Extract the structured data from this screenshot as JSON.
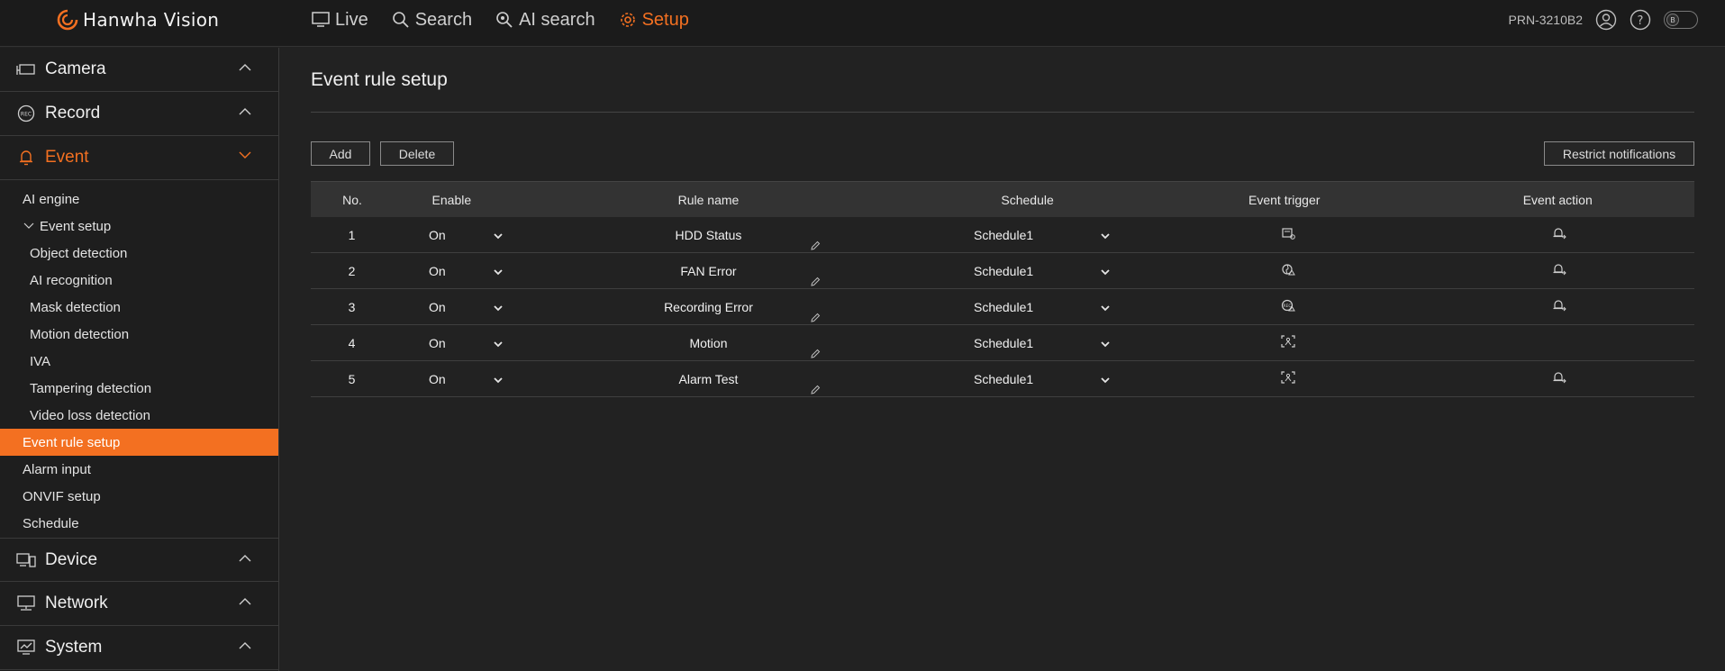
{
  "app": {
    "logo_text": "Hanwha Vision",
    "model": "PRN-3210B2",
    "toggle_label": "B"
  },
  "colors": {
    "accent": "#f37021",
    "bg": "#222222",
    "header_row": "#333333"
  },
  "nav": [
    {
      "label": "Live",
      "icon": "monitor-icon"
    },
    {
      "label": "Search",
      "icon": "search-icon"
    },
    {
      "label": "AI search",
      "icon": "ai-search-icon"
    },
    {
      "label": "Setup",
      "icon": "gear-icon",
      "active": true
    }
  ],
  "sidebar": {
    "camera": "Camera",
    "record": "Record",
    "event": "Event",
    "event_items": {
      "ai_engine": "AI engine",
      "event_setup": "Event setup",
      "object_detection": "Object detection",
      "ai_recognition": "AI recognition",
      "mask_detection": "Mask detection",
      "motion_detection": "Motion detection",
      "iva": "IVA",
      "tampering_detection": "Tampering detection",
      "video_loss_detection": "Video loss detection",
      "event_rule_setup": "Event rule setup",
      "alarm_input": "Alarm input",
      "onvif_setup": "ONVIF setup",
      "schedule": "Schedule"
    },
    "device": "Device",
    "network": "Network",
    "system": "System"
  },
  "main": {
    "title": "Event rule setup",
    "add": "Add",
    "delete": "Delete",
    "restrict": "Restrict notifications",
    "headers": {
      "no": "No.",
      "enable": "Enable",
      "rule_name": "Rule name",
      "schedule": "Schedule",
      "event_trigger": "Event trigger",
      "event_action": "Event action"
    },
    "rows": [
      {
        "no": "1",
        "enable": "On",
        "name": "HDD Status",
        "schedule": "Schedule1",
        "trigger_icon": "hdd-icon",
        "action_icon": "bell-action-icon"
      },
      {
        "no": "2",
        "enable": "On",
        "name": "FAN Error",
        "schedule": "Schedule1",
        "trigger_icon": "fan-error-icon",
        "action_icon": "bell-action-icon"
      },
      {
        "no": "3",
        "enable": "On",
        "name": "Recording Error",
        "schedule": "Schedule1",
        "trigger_icon": "rec-error-icon",
        "action_icon": "bell-action-icon"
      },
      {
        "no": "4",
        "enable": "On",
        "name": "Motion",
        "schedule": "Schedule1",
        "trigger_icon": "motion-icon",
        "action_icon": ""
      },
      {
        "no": "5",
        "enable": "On",
        "name": "Alarm Test",
        "schedule": "Schedule1",
        "trigger_icon": "motion-icon",
        "action_icon": "bell-action-icon"
      }
    ]
  }
}
